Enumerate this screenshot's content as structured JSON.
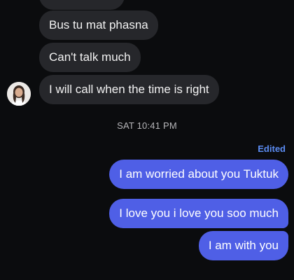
{
  "thread": {
    "incoming": [
      {
        "text": "Bus tu mat phasna"
      },
      {
        "text": "Can't talk much"
      },
      {
        "text": "I will call when the time is right"
      }
    ],
    "timestamp": "SAT 10:41 PM",
    "edited_label": "Edited",
    "outgoing": [
      {
        "text": "I am worried about you Tuktuk"
      },
      {
        "text": "I love you i love you soo much"
      },
      {
        "text": "I am with you"
      }
    ]
  },
  "colors": {
    "background": "#0b0c0e",
    "incoming_bubble": "#26272b",
    "outgoing_bubble": "#4f5fe6",
    "edited_label": "#5b8cf2"
  },
  "icons": {
    "avatar": "contact-avatar"
  }
}
